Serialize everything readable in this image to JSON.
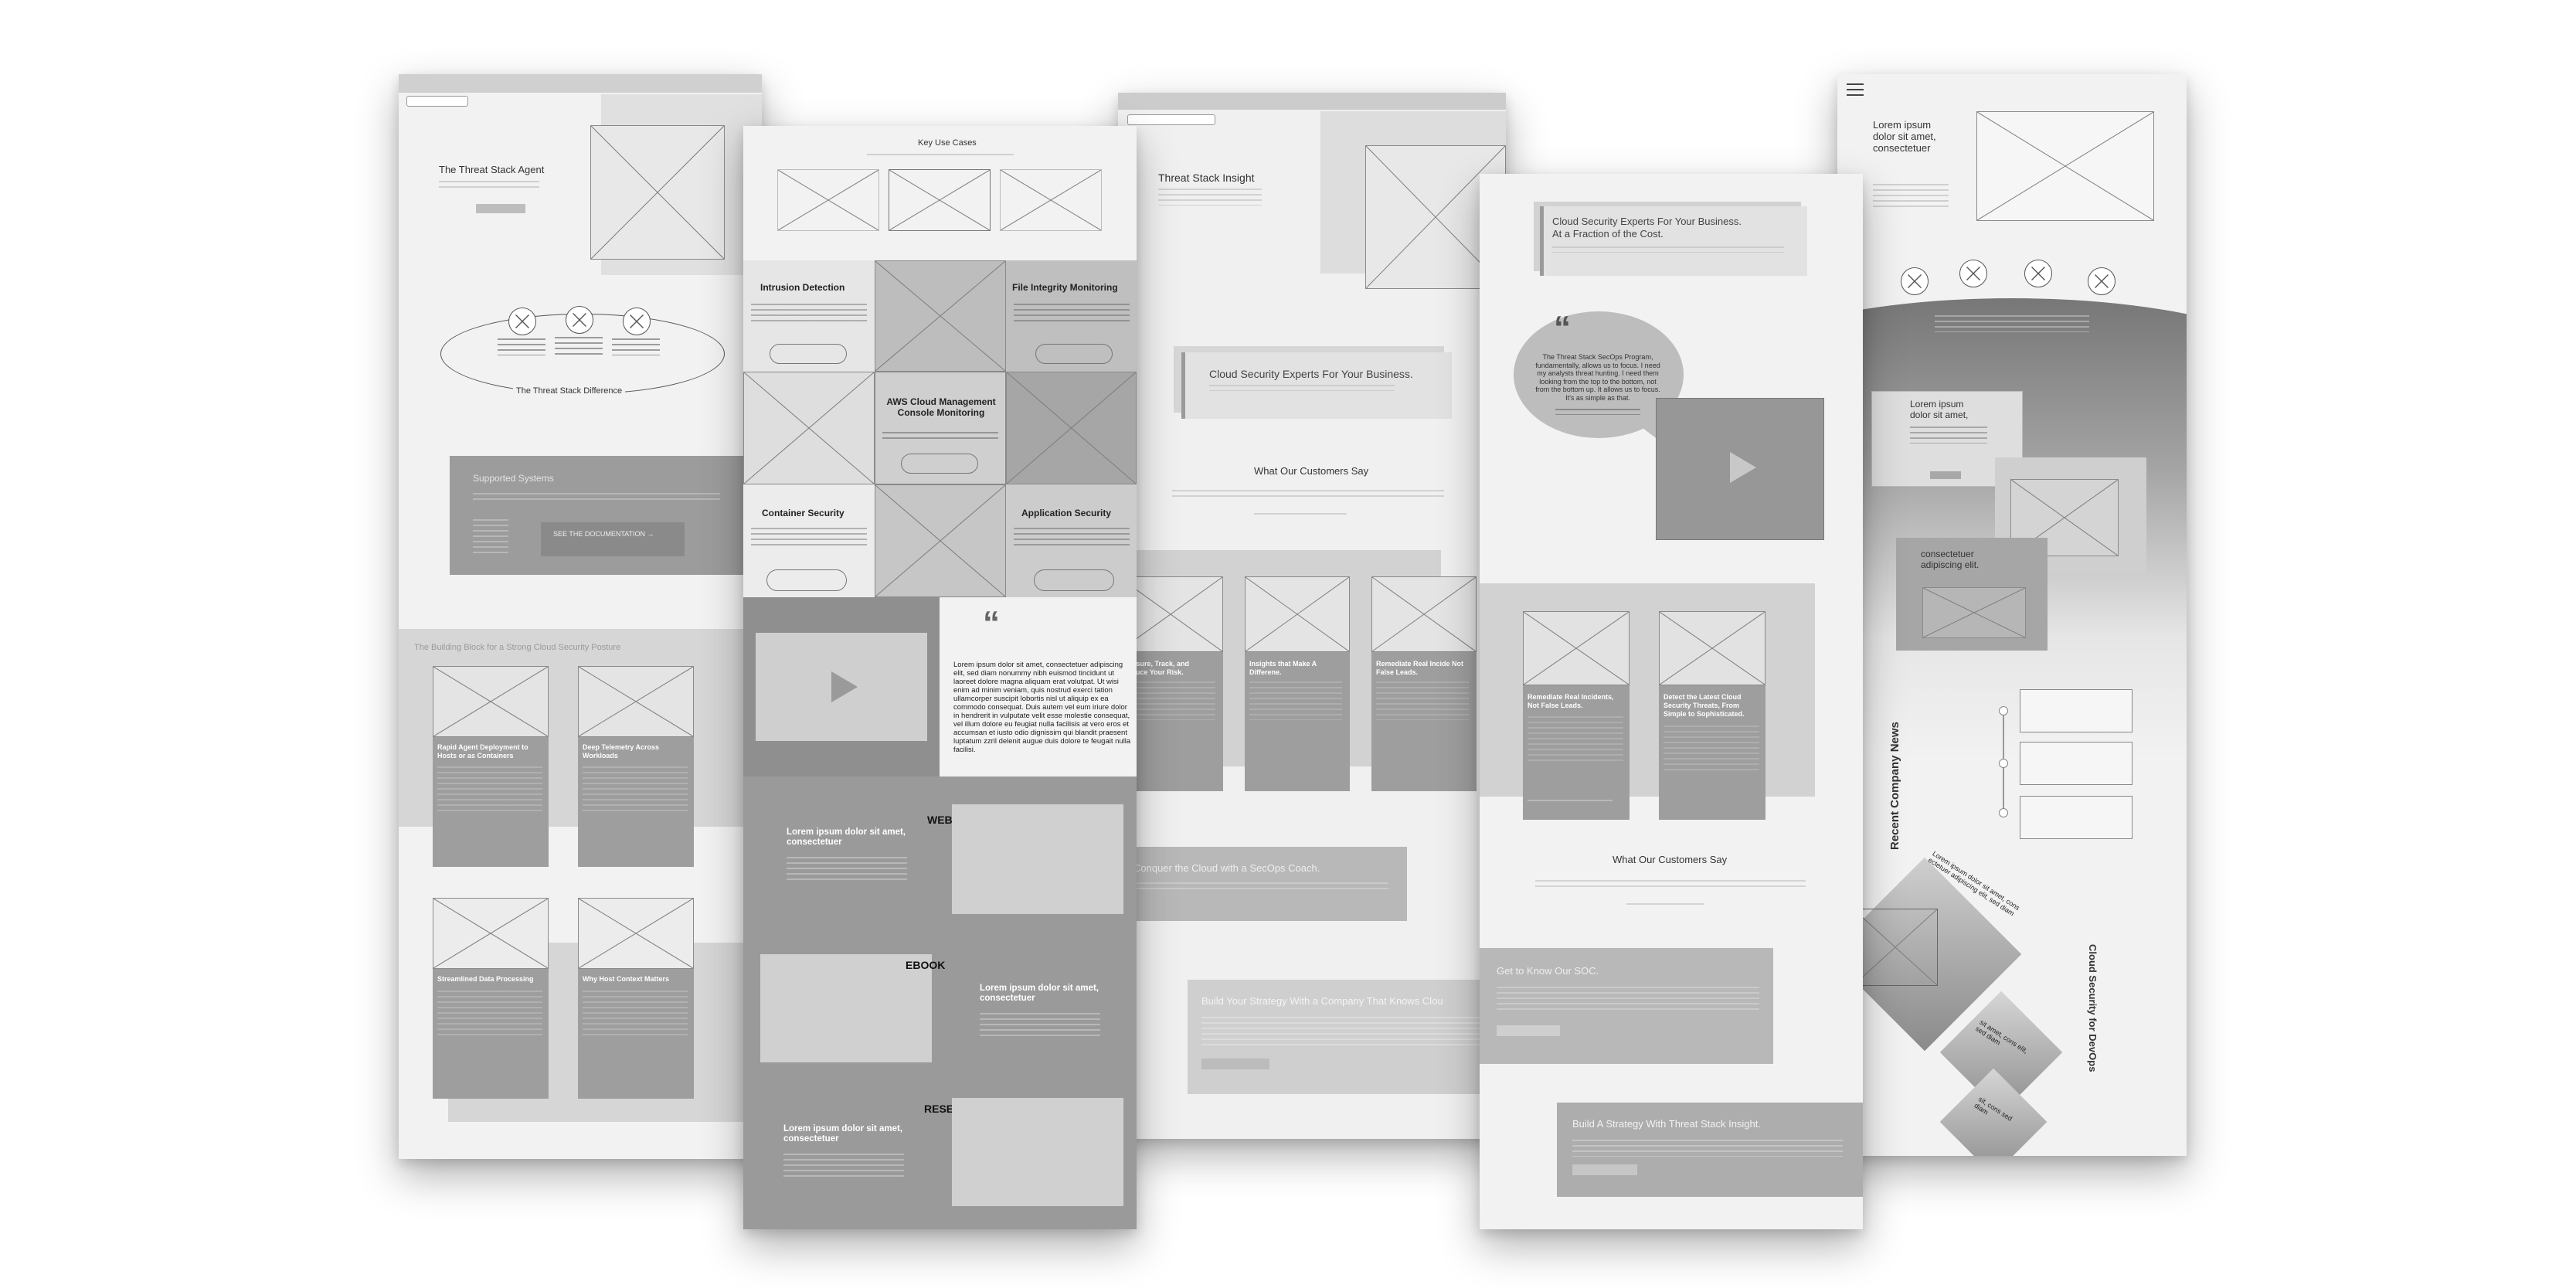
{
  "panel1": {
    "hero_title": "The Threat Stack Agent",
    "difference_title": "The Threat Stack Difference",
    "supported_title": "Supported Systems",
    "doc_button": "SEE THE DOCUMENTATION →",
    "building_title": "The Building Block for a Strong Cloud Security Posture",
    "cards": [
      "Rapid Agent Deployment to Hosts or as Containers",
      "Deep Telemetry Across Workloads",
      "Streamlined Data Processing",
      "Why Host Context Matters"
    ]
  },
  "panel2": {
    "title": "Key Use Cases",
    "uc_intrusion": "Intrusion Detection",
    "uc_file": "File Integrity Monitoring",
    "uc_aws": "AWS Cloud Management Console Monitoring",
    "uc_container": "Container Security",
    "uc_application": "Application Security",
    "quote": "Lorem ipsum dolor sit amet, consectetuer adipiscing elit, sed diam nonummy nibh euismod tincidunt ut laoreet dolore magna aliquam erat volutpat. Ut wisi enim ad minim veniam, quis nostrud exerci tation ullamcorper suscipit lobortis nisl ut aliquip ex ea commodo consequat. Duis autem vel eum iriure dolor in hendrerit in vulputate velit esse molestie consequat, vel illum dolore eu feugiat nulla facilisis at vero eros et accumsan et iusto odio dignissim qui blandit praesent luptatum zzril delenit augue duis dolore te feugait nulla facilisi.",
    "webinar_label": "WEBINAR",
    "ebook_label": "EBOOK",
    "research_label": "RESEARCH",
    "lorem_heading": "Lorem ipsum dolor sit amet, consectetuer"
  },
  "panel3": {
    "title": "Threat Stack Insight",
    "banner": "Cloud Security Experts For Your Business.",
    "customers_title": "What Our Customers Say",
    "cards": [
      "Measure, Track, and Reduce Your Risk.",
      "Insights that Make A Differene.",
      "Remediate Real Incide Not False Leads."
    ],
    "conquer": "Conquer the Cloud with a SecOps Coach.",
    "strategy": "Build Your Strategy With a Company That Knows Clou"
  },
  "panel4": {
    "banner_line1": "Cloud Security Experts For Your Business.",
    "banner_line2": "At a Fraction of the Cost.",
    "speech": "The Threat Stack SecOps Program, fundamentally, allows us to focus. I need my analysts threat hunting. I need them looking from the top to the bottom, not from the bottom up. It allows us to focus. It's as simple as that.",
    "cards": [
      "Remediate Real Incidents, Not False Leads.",
      "Detect the Latest Cloud Security Threats, From Simple to Sophisticated."
    ],
    "customers_title": "What Our Customers Say",
    "soc_title": "Get to Know Our SOC.",
    "strategy": "Build A Strategy With Threat Stack Insight."
  },
  "panel5": {
    "hero_text": "Lorem ipsum dolor sit amet, consectetuer",
    "card1": "Lorem ipsum dolor sit amet,",
    "card2": "consectetuer adipiscing elit.",
    "news_title": "Recent Company News",
    "devops_title": "Cloud Security for DevOps",
    "diamond1": "Lorem ipsum dolor sit amet, cons ectetuer adipiscing elit, sed diam",
    "diamond2": "sit amet, cons elit, sed diam",
    "diamond3": "sit, cons sed diam"
  }
}
